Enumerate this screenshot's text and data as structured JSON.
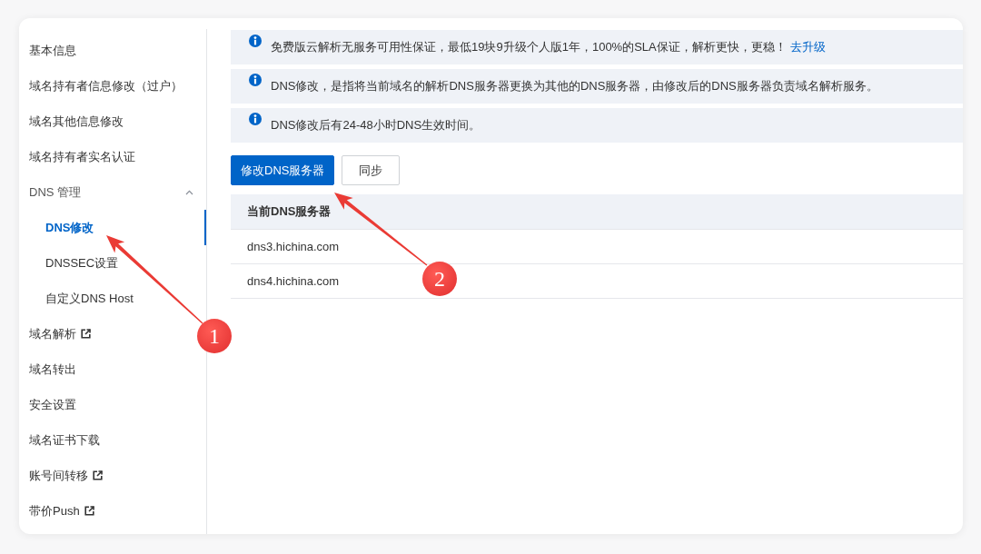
{
  "sidebar": {
    "items": [
      {
        "label": "基本信息",
        "kind": "item",
        "selected": false,
        "external": false
      },
      {
        "label": "域名持有者信息修改（过户）",
        "kind": "item",
        "selected": false,
        "external": false
      },
      {
        "label": "域名其他信息修改",
        "kind": "item",
        "selected": false,
        "external": false
      },
      {
        "label": "域名持有者实名认证",
        "kind": "item",
        "selected": false,
        "external": false
      },
      {
        "label": "DNS 管理",
        "kind": "group",
        "selected": false,
        "expanded": true,
        "children": [
          {
            "label": "DNS修改",
            "selected": true
          },
          {
            "label": "DNSSEC设置",
            "selected": false
          },
          {
            "label": "自定义DNS Host",
            "selected": false
          }
        ]
      },
      {
        "label": "域名解析",
        "kind": "item",
        "selected": false,
        "external": true
      },
      {
        "label": "域名转出",
        "kind": "item",
        "selected": false,
        "external": false
      },
      {
        "label": "安全设置",
        "kind": "item",
        "selected": false,
        "external": false
      },
      {
        "label": "域名证书下载",
        "kind": "item",
        "selected": false,
        "external": false
      },
      {
        "label": "账号间转移",
        "kind": "item",
        "selected": false,
        "external": true
      },
      {
        "label": "带价Push",
        "kind": "item",
        "selected": false,
        "external": true
      }
    ]
  },
  "notices": [
    {
      "text": "免费版云解析无服务可用性保证，最低19块9升级个人版1年，100%的SLA保证，解析更快，更稳！",
      "link": "去升级"
    },
    {
      "text": "DNS修改，是指将当前域名的解析DNS服务器更换为其他的DNS服务器，由修改后的DNS服务器负责域名解析服务。"
    },
    {
      "text": "DNS修改后有24-48小时DNS生效时间。"
    }
  ],
  "buttons": [
    {
      "label": "修改DNS服务器",
      "kind": "primary"
    },
    {
      "label": "同步",
      "kind": "default"
    }
  ],
  "table": {
    "columns": [
      "当前DNS服务器"
    ],
    "rows": [
      [
        "dns3.hichina.com"
      ],
      [
        "dns4.hichina.com"
      ]
    ]
  },
  "annotations": [
    {
      "label": "1"
    },
    {
      "label": "2"
    }
  ]
}
